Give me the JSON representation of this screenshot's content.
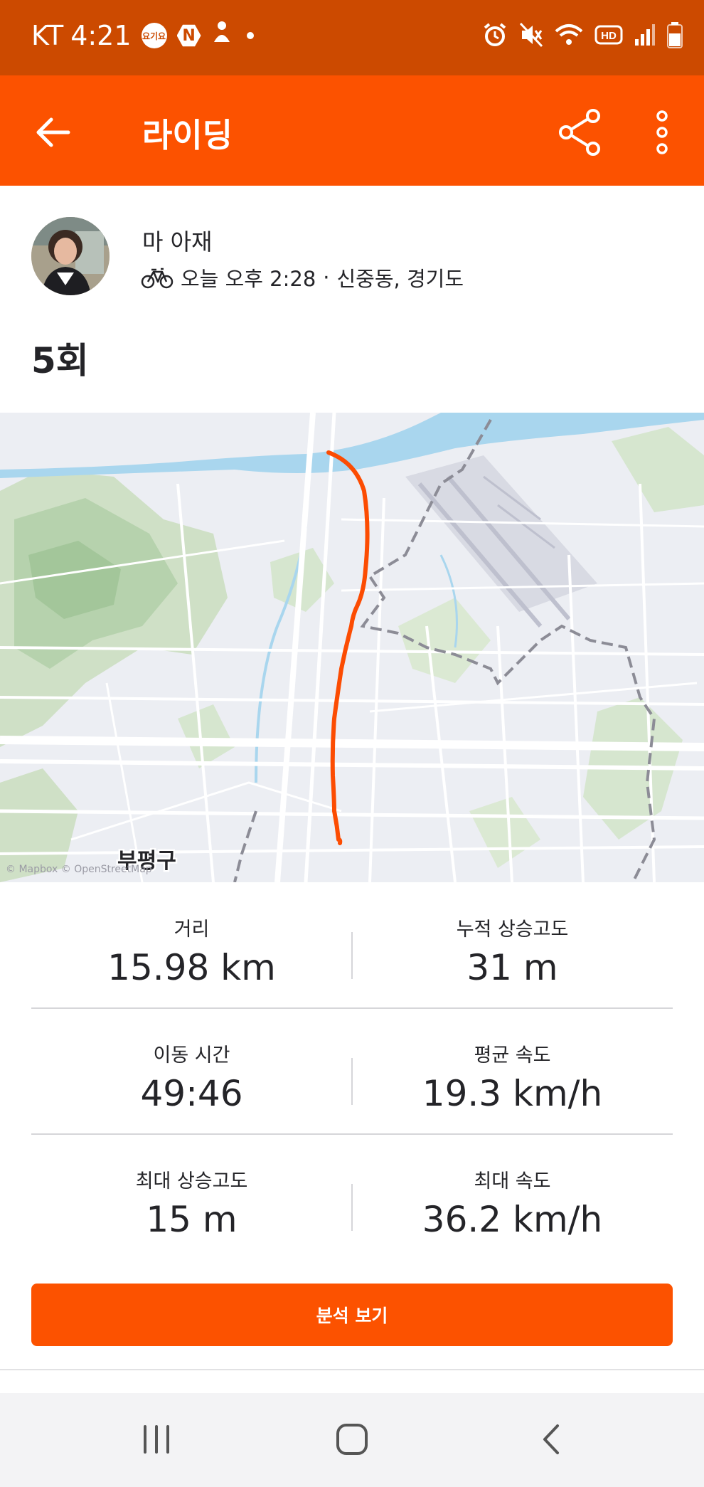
{
  "status_bar": {
    "carrier": "KT",
    "time": "4:21",
    "badge_1": "요기요",
    "badge_2": "N"
  },
  "app_bar": {
    "title": "라이딩",
    "back_icon": "arrow-left-icon",
    "share_icon": "share-icon",
    "more_icon": "more-vertical-icon"
  },
  "activity": {
    "athlete_name": "마 아재",
    "time": "오늘 오후 2:28",
    "location": "신중동, 경기도",
    "separator": "·",
    "title": "5회"
  },
  "map": {
    "district_label": "부평구",
    "attribution": "© Mapbox © OpenStreetMap",
    "route_color": "#fc4c02"
  },
  "stats": [
    {
      "left": {
        "label": "거리",
        "value": "15.98 km"
      },
      "right": {
        "label": "누적 상승고도",
        "value": "31 m"
      }
    },
    {
      "left": {
        "label": "이동 시간",
        "value": "49:46"
      },
      "right": {
        "label": "평균 속도",
        "value": "19.3 km/h"
      }
    },
    {
      "left": {
        "label": "최대 상승고도",
        "value": "15 m"
      },
      "right": {
        "label": "최대 속도",
        "value": "36.2 km/h"
      }
    }
  ],
  "analysis_button": {
    "label": "분석 보기"
  },
  "colors": {
    "brand": "#fc5200",
    "status_bar": "#cc4a00"
  }
}
